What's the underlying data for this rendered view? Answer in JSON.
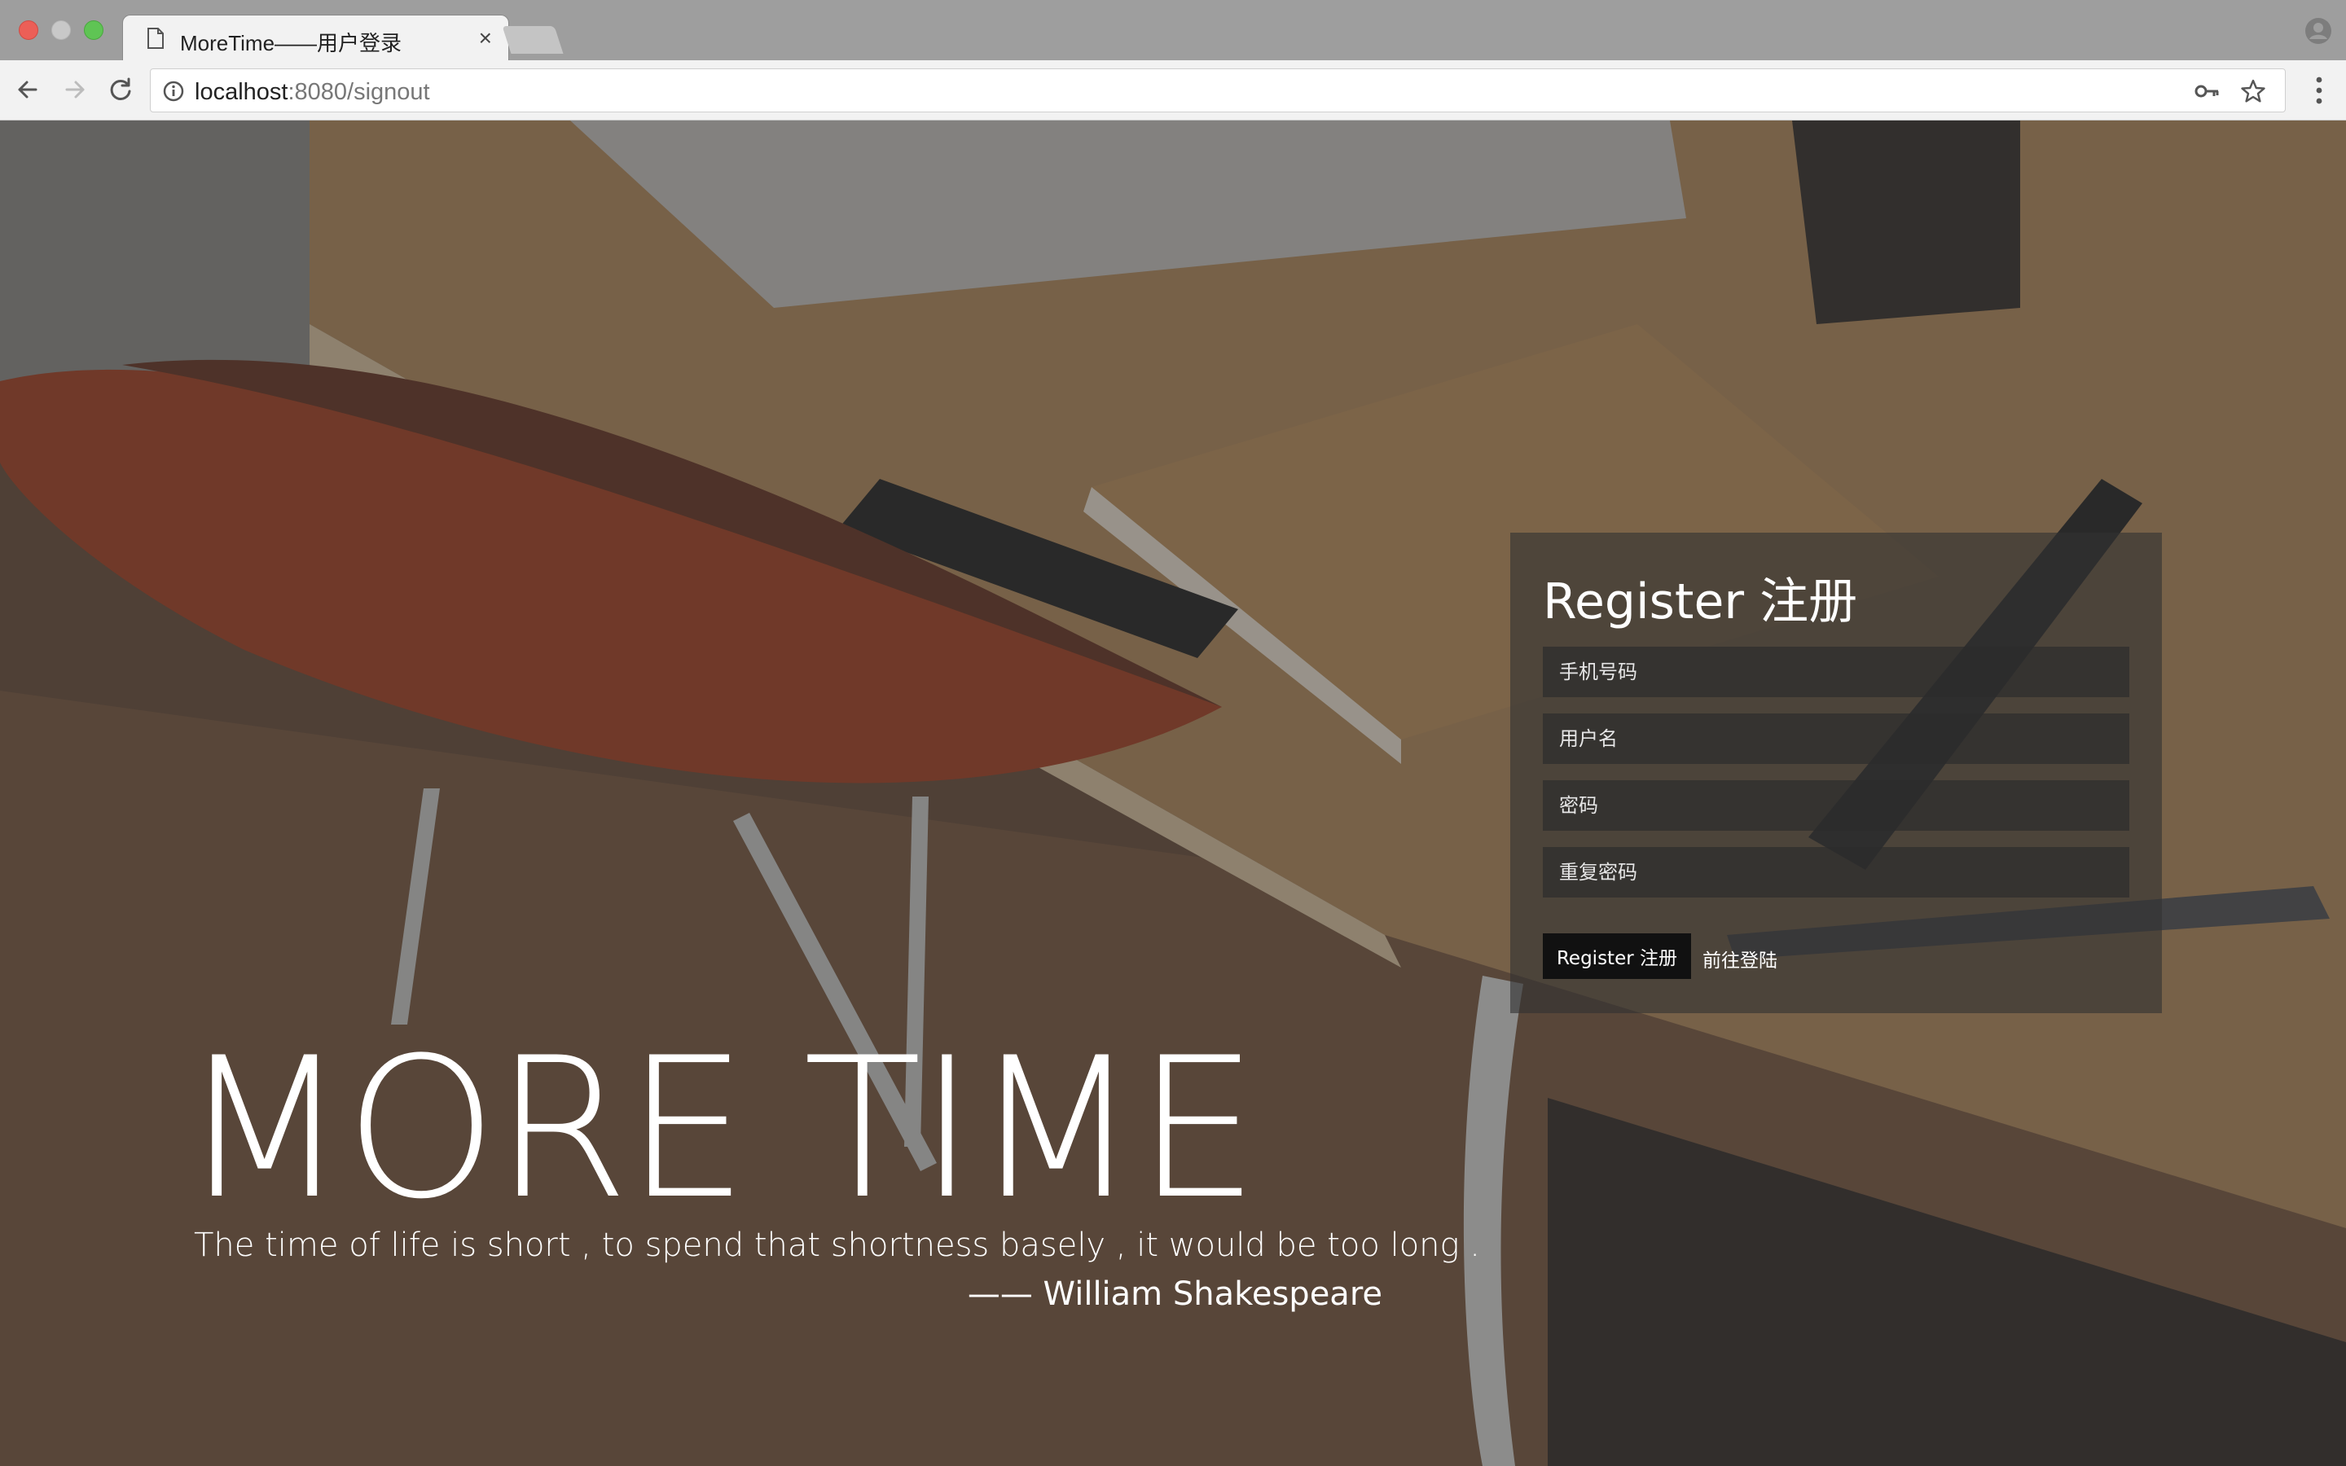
{
  "browser": {
    "tab_title": "MoreTime——用户登录",
    "tab_close": "×",
    "url_host": "localhost",
    "url_path": ":8080/signout"
  },
  "hero": {
    "title": "MORE TIME",
    "quote": "The time of life is short , to spend that shortness basely , it would be too long .",
    "author": "—— William Shakespeare"
  },
  "register": {
    "title": "Register 注册",
    "phone_placeholder": "手机号码",
    "username_placeholder": "用户名",
    "password_placeholder": "密码",
    "repeat_password_placeholder": "重复密码",
    "submit_label": "Register 注册",
    "login_link": "前往登陆"
  },
  "icons": {
    "tab": "page-icon",
    "back": "arrow-left-icon",
    "forward": "arrow-right-icon",
    "reload": "reload-icon",
    "info": "info-icon",
    "key": "key-icon",
    "star": "star-icon",
    "menu": "kebab-menu-icon",
    "profile": "profile-icon"
  },
  "colors": {
    "chrome_bar": "#9e9e9e",
    "toolbar": "#f2f2f2",
    "panel_bg": "rgba(50,50,50,0.62)",
    "button_bg": "#111111",
    "text_light": "#ffffff"
  }
}
